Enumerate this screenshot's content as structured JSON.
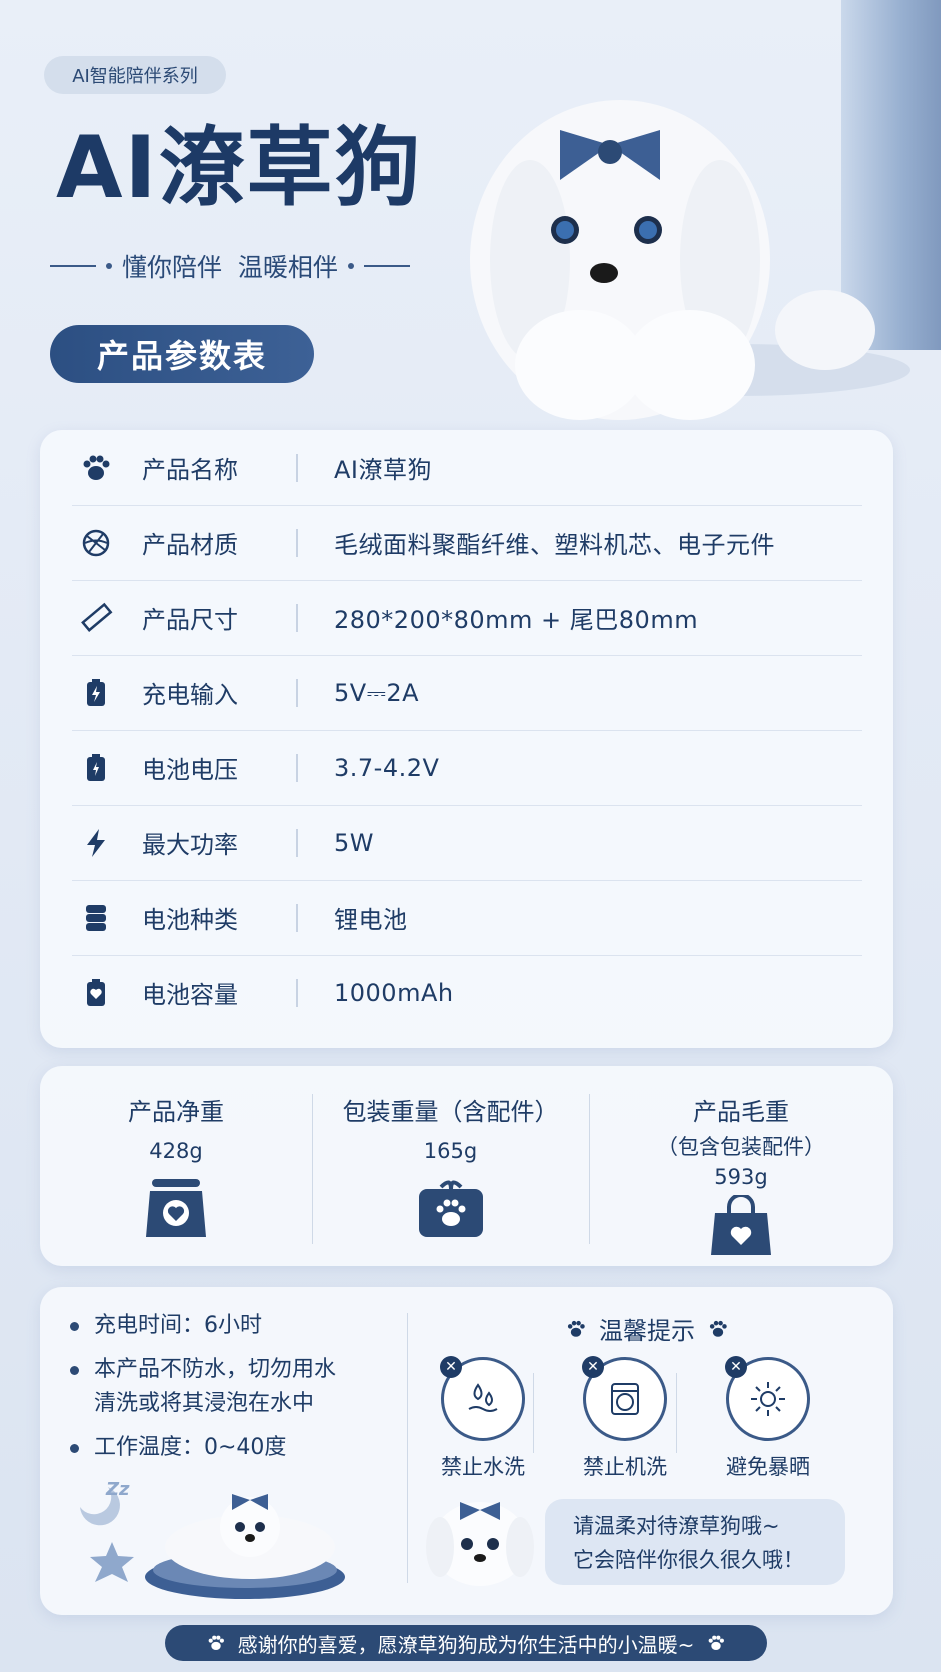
{
  "header": {
    "series": "AI智能陪伴系列",
    "title": "AI潦草狗",
    "subtitle": "懂你陪伴  温暖相伴",
    "section_tag": "产品参数表"
  },
  "specs": [
    {
      "icon": "paw-icon",
      "label": "产品名称",
      "value": "AI潦草狗"
    },
    {
      "icon": "yarn-ball-icon",
      "label": "产品材质",
      "value": "毛绒面料聚酯纤维、塑料机芯、电子元件"
    },
    {
      "icon": "ruler-icon",
      "label": "产品尺寸",
      "value": "280*200*80mm + 尾巴80mm"
    },
    {
      "icon": "charging-battery-icon",
      "label": "充电输入",
      "value": "5V⎓2A"
    },
    {
      "icon": "battery-bolt-icon",
      "label": "电池电压",
      "value": "3.7-4.2V"
    },
    {
      "icon": "lightning-icon",
      "label": "最大功率",
      "value": "5W"
    },
    {
      "icon": "battery-cells-icon",
      "label": "电池种类",
      "value": "锂电池"
    },
    {
      "icon": "battery-heart-icon",
      "label": "电池容量",
      "value": "1000mAh"
    }
  ],
  "weights": [
    {
      "title": "产品净重",
      "sub": "",
      "value": "428g",
      "icon": "scale-heart-icon"
    },
    {
      "title": "包装重量（含配件）",
      "sub": "",
      "value": "165g",
      "icon": "gift-box-paw-icon"
    },
    {
      "title": "产品毛重",
      "sub": "（包含包装配件）",
      "value": "593g",
      "icon": "shopping-bag-heart-icon"
    }
  ],
  "notes": [
    "充电时间：6小时",
    "本产品不防水，切勿用水",
    "清洗或将其浸泡在水中",
    "工作温度：0~40度"
  ],
  "tips": {
    "title": "温馨提示",
    "warnings": [
      {
        "icon": "water-drops-icon",
        "label": "禁止水洗"
      },
      {
        "icon": "washing-machine-icon",
        "label": "禁止机洗"
      },
      {
        "icon": "sun-icon",
        "label": "避免暴晒"
      }
    ],
    "bubble_line1": "请温柔对待潦草狗哦~",
    "bubble_line2": "它会陪伴你很久很久哦！",
    "sleep_text": "Zz"
  },
  "footer": "感谢你的喜爱，愿潦草狗狗成为你生活中的小温暖~",
  "colors": {
    "primary": "#1f3c66",
    "accent": "#3b5a88",
    "bg": "#e6edf7"
  }
}
